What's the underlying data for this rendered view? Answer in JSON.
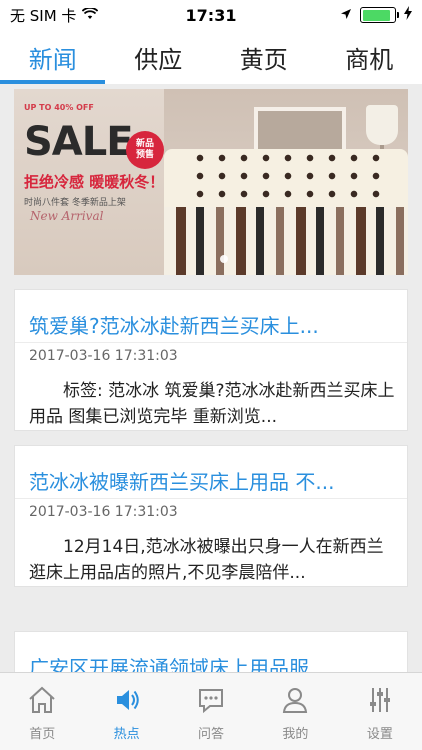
{
  "status": {
    "carrier": "无 SIM 卡",
    "time": "17:31",
    "colors": {
      "battery": "#4cd964"
    }
  },
  "tabs": [
    {
      "label": "新闻",
      "active": true
    },
    {
      "label": "供应",
      "active": false
    },
    {
      "label": "黄页",
      "active": false
    },
    {
      "label": "商机",
      "active": false
    }
  ],
  "banner": {
    "promo_tag": "UP TO 40% OFF",
    "sale": "SALE",
    "badge": "新品\n预售",
    "slogan": "拒绝冷感  暖暖秋冬！",
    "sub": "时尚八件套   冬季新品上架",
    "script": "New Arrival"
  },
  "articles": [
    {
      "title": "筑爱巢?范冰冰赴新西兰买床上...",
      "date": "2017-03-16 17:31:03",
      "summary": "标签: 范冰冰 筑爱巢?范冰冰赴新西兰买床上用品 图集已浏览完毕 重新浏览..."
    },
    {
      "title": "范冰冰被曝新西兰买床上用品 不...",
      "date": "2017-03-16 17:31:03",
      "summary": "12月14日,范冰冰被曝出只身一人在新西兰逛床上用品店的照片,不见李晨陪伴..."
    },
    {
      "title": "广安区开展流通领域床上用品服...",
      "date": "",
      "summary": ""
    }
  ],
  "bottom_nav": [
    {
      "label": "首页",
      "icon": "home-icon",
      "active": false
    },
    {
      "label": "热点",
      "icon": "speaker-icon",
      "active": true
    },
    {
      "label": "问答",
      "icon": "chat-icon",
      "active": false
    },
    {
      "label": "我的",
      "icon": "user-icon",
      "active": false
    },
    {
      "label": "设置",
      "icon": "settings-sliders-icon",
      "active": false
    }
  ],
  "colors": {
    "accent": "#2a8fde",
    "background": "#ececec",
    "inactive": "#8a8a8a"
  }
}
